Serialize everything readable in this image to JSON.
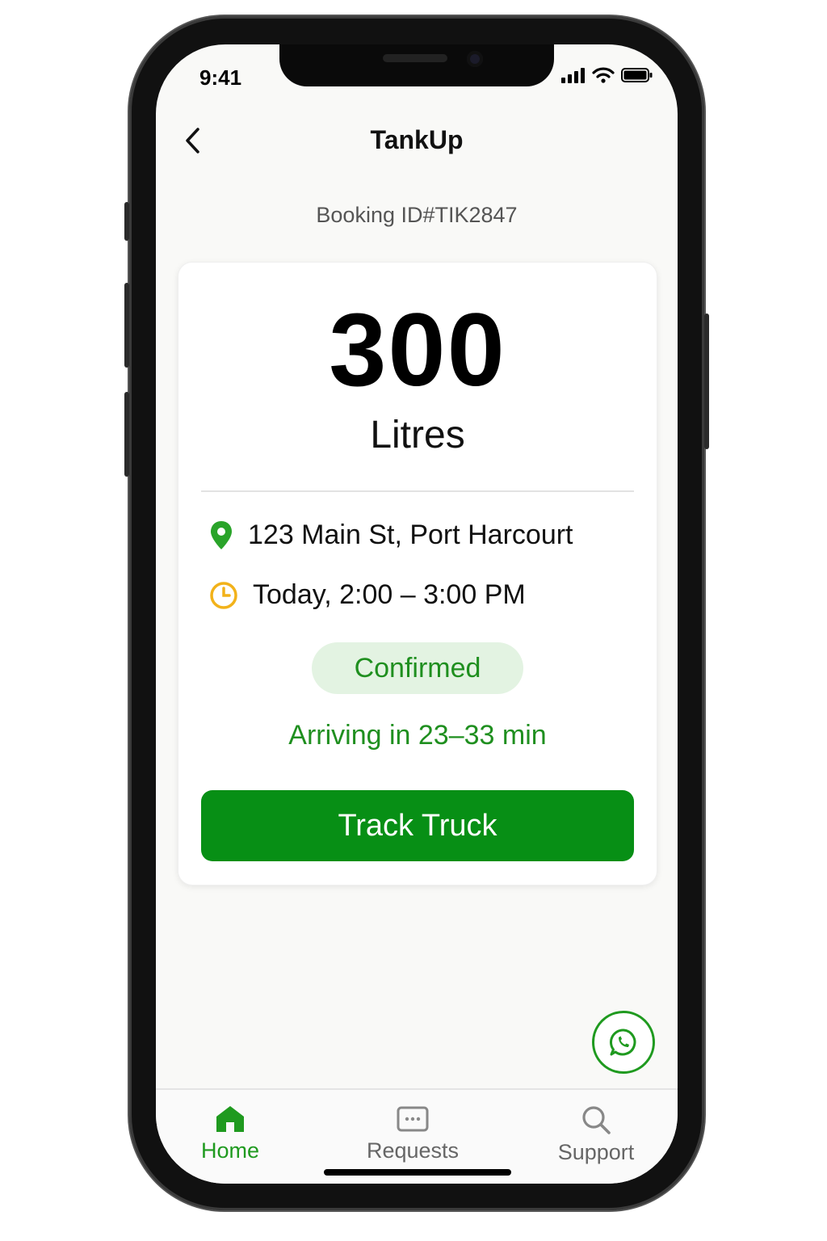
{
  "status_bar": {
    "time": "9:41"
  },
  "header": {
    "title": "TankUp"
  },
  "booking": {
    "id_text": "Booking ID#TIK2847",
    "amount": "300",
    "unit": "Litres",
    "address": "123 Main St, Port Harcourt",
    "time_window": "Today, 2:00 – 3:00 PM",
    "status": "Confirmed",
    "eta": "Arriving in 23–33 min",
    "track_button": "Track Truck"
  },
  "tabs": [
    {
      "label": "Home",
      "icon": "home-icon",
      "active": true
    },
    {
      "label": "Requests",
      "icon": "requests-icon",
      "active": false
    },
    {
      "label": "Support",
      "icon": "search-icon",
      "active": false
    }
  ],
  "colors": {
    "primary_green": "#078f15",
    "text_green": "#1f8f1f",
    "badge_bg": "#e3f3e2",
    "clock_yellow": "#f2b21a",
    "pin_green": "#2aa42a"
  }
}
